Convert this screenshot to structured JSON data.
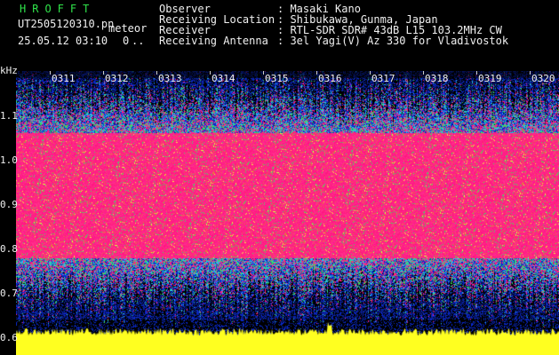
{
  "header": {
    "brand": "HROFFT",
    "filename": "UT2505120310.pn",
    "meteor_label": "meteor",
    "datetime": "25.05.12 03:10",
    "count": "0",
    "dots": ".."
  },
  "station": {
    "observer_label": "Observer",
    "observer_value": ": Masaki Kano",
    "location_label": "Receiving Location",
    "location_value": ": Shibukawa, Gunma, Japan",
    "receiver_label": "Receiver",
    "receiver_value": ": RTL-SDR SDR# 43dB L15 103.2MHz CW",
    "antenna_label": "Receiving Antenna",
    "antenna_value": ": 3el Yagi(V) Az 330 for Vladivostok"
  },
  "axes": {
    "y_unit": "kHz",
    "y_ticks": [
      "1.1",
      "1.0",
      "0.9",
      "0.8",
      "0.7",
      "0.6"
    ],
    "x_ticks": [
      "0311",
      "0312",
      "0313",
      "0314",
      "0315",
      "0316",
      "0317",
      "0318",
      "0319",
      "0320"
    ]
  },
  "colors": {
    "background": "#000000",
    "signal_pink": "#ff1f7a",
    "noise_blue": "#1030c0",
    "noise_cyan": "#20c0ff",
    "noise_green": "#30ff60",
    "baseline_yellow": "#ffff20"
  }
}
